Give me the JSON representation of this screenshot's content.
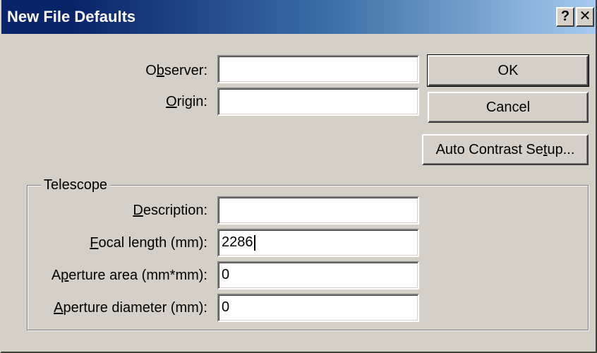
{
  "window": {
    "title": "New File Defaults",
    "help_glyph": "?",
    "close_glyph": "✕"
  },
  "fields": {
    "observer": {
      "label_pre": "O",
      "label_acc": "b",
      "label_post": "server:",
      "value": ""
    },
    "origin": {
      "label_pre": "",
      "label_acc": "O",
      "label_post": "rigin:",
      "value": ""
    }
  },
  "telescope": {
    "group_label": "Telescope",
    "description": {
      "label_pre": "",
      "label_acc": "D",
      "label_post": "escription:",
      "value": ""
    },
    "focal_length": {
      "label_pre": "",
      "label_acc": "F",
      "label_post": "ocal length (mm):",
      "value": "2286"
    },
    "aperture_area": {
      "label_pre": "A",
      "label_acc": "p",
      "label_post": "erture area (mm*mm):",
      "value": "0"
    },
    "aperture_diameter": {
      "label_pre": "",
      "label_acc": "A",
      "label_post": "perture diameter (mm):",
      "value": "0"
    }
  },
  "buttons": {
    "ok": "OK",
    "cancel": "Cancel",
    "auto_contrast_pre": "Auto Contrast Se",
    "auto_contrast_acc": "t",
    "auto_contrast_post": "up..."
  }
}
